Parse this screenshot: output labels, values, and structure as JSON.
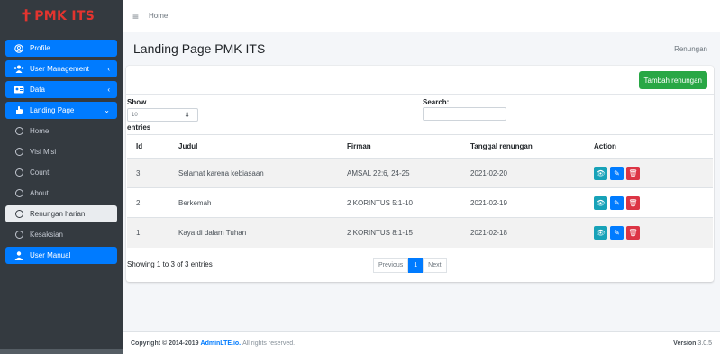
{
  "brand": {
    "symbol": "✝",
    "name": "PMK ITS"
  },
  "sidebar": {
    "items": [
      {
        "label": "Profile",
        "icon": "user-circle-icon",
        "state": "active"
      },
      {
        "label": "User Management",
        "icon": "users-icon",
        "state": "normal",
        "chevron": "‹"
      },
      {
        "label": "Data",
        "icon": "user-tie-icon",
        "state": "normal",
        "chevron": "‹"
      },
      {
        "label": "Landing Page",
        "icon": "hand-icon",
        "state": "active",
        "chevron": "⌄"
      },
      {
        "label": "Home",
        "icon": "circle-icon",
        "state": "normal"
      },
      {
        "label": "Visi Misi",
        "icon": "circle-icon",
        "state": "normal"
      },
      {
        "label": "Count",
        "icon": "circle-icon",
        "state": "normal"
      },
      {
        "label": "About",
        "icon": "circle-icon",
        "state": "normal"
      },
      {
        "label": "Renungan harian",
        "icon": "circle-icon",
        "state": "light"
      },
      {
        "label": "Kesaksian",
        "icon": "circle-icon",
        "state": "normal"
      },
      {
        "label": "User Manual",
        "icon": "user-manual-icon",
        "state": "active"
      }
    ]
  },
  "topbar": {
    "menu_icon": "≡",
    "home": "Home"
  },
  "header": {
    "title": "Landing Page PMK ITS",
    "breadcrumb": "Renungan"
  },
  "card": {
    "add_button": "Tambah renungan",
    "show_label": "Show",
    "show_value": "10",
    "entries_label": "entries",
    "search_label": "Search:",
    "search_value": ""
  },
  "table": {
    "columns": [
      "Id",
      "Judul",
      "Firman",
      "Tanggal renungan",
      "Action"
    ],
    "rows": [
      {
        "id": "3",
        "judul": "Selamat karena kebiasaan",
        "firman": "AMSAL 22:6, 24-25",
        "tanggal": "2021-02-20"
      },
      {
        "id": "2",
        "judul": "Berkemah",
        "firman": "2 KORINTUS 5:1-10",
        "tanggal": "2021-02-19"
      },
      {
        "id": "1",
        "judul": "Kaya di dalam Tuhan",
        "firman": "2 KORINTUS 8:1-15",
        "tanggal": "2021-02-18"
      }
    ]
  },
  "pagination": {
    "info": "Showing 1 to 3 of 3 entries",
    "previous": "Previous",
    "current": "1",
    "next": "Next"
  },
  "footer": {
    "copyright": "Copyright © 2014-2019",
    "link": "AdminLTE.io.",
    "rights": "All rights reserved.",
    "version_label": "Version",
    "version": "3.0.5"
  },
  "colors": {
    "sidebar_bg": "#343a40",
    "brand": "#e3342f",
    "primary": "#007bff",
    "success": "#28a745",
    "info": "#17a2b8",
    "danger": "#dc3545"
  }
}
